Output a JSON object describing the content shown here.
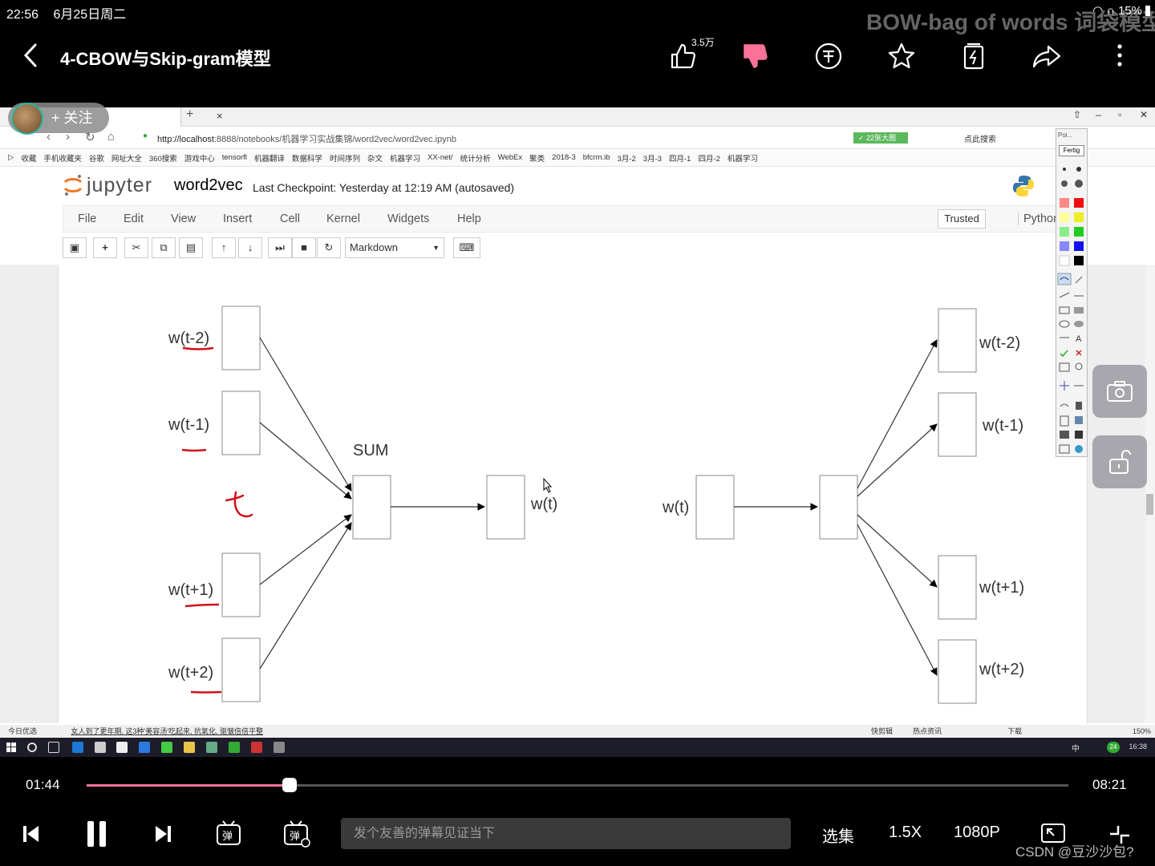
{
  "status_bar": {
    "time": "22:56",
    "date": "6月25日周二",
    "battery": "15%"
  },
  "watermark": "BOW-bag of words 词袋模型",
  "video": {
    "title": "4-CBOW与Skip-gram模型",
    "like_count": "3.5万",
    "icons": [
      "like-icon",
      "dislike-icon",
      "coin-icon",
      "star-icon",
      "collect-icon",
      "share-icon",
      "more-icon"
    ]
  },
  "follow": {
    "label": "+ 关注"
  },
  "browser": {
    "url_host": "http://localhost",
    "url_path": ":8888/notebooks/机器学习实战集锦/word2vec/word2vec.ipynb",
    "badge": "✓ 22张大图",
    "search_label": "点此搜索",
    "bookmarks": [
      "收藏",
      "手机收藏夹",
      "谷歌",
      "网址大全",
      "360搜索",
      "游戏中心",
      "tensorfl",
      "机器翻译",
      "数据科学",
      "时间序列",
      "杂文",
      "机器学习",
      "XX-net/",
      "统计分析",
      "WebEx",
      "聚类",
      "2018-3",
      "bfcrm.ib",
      "3月-2",
      "3月-3",
      "四月-1",
      "四月-2",
      "机器学习"
    ]
  },
  "jupyter": {
    "logo_text": "jupyter",
    "notebook_name": "word2vec",
    "checkpoint": "Last Checkpoint: Yesterday at 12:19 AM (autosaved)",
    "menu": [
      "File",
      "Edit",
      "View",
      "Insert",
      "Cell",
      "Kernel",
      "Widgets",
      "Help"
    ],
    "trusted": "Trusted",
    "kernel": "Python",
    "cell_type": "Markdown"
  },
  "diagram": {
    "cbow": {
      "inputs": [
        "w(t-2)",
        "w(t-1)",
        "w(t+1)",
        "w(t+2)"
      ],
      "sum_label": "SUM",
      "output": "w(t)",
      "handwritten_mark": "t"
    },
    "skipgram": {
      "input": "w(t)",
      "outputs": [
        "w(t-2)",
        "w(t-1)",
        "w(t+1)",
        "w(t+2)"
      ]
    }
  },
  "annotation_tool": {
    "fertig": "Fertig",
    "title": "Poi..."
  },
  "ie_status": {
    "left": "今日优选",
    "news": "女人到了更年期, 这3种'美容汤'吃起来, 抗氧化, 驱皱倍倍平整",
    "zoom": "150%",
    "items": [
      "快剪辑",
      "热点资讯",
      "下载"
    ]
  },
  "taskbar": {
    "clock": "16:38",
    "badge": "24",
    "ime": "中"
  },
  "playback": {
    "current": "01:44",
    "total": "08:21",
    "progress": 0.207,
    "danmaku_placeholder": "发个友善的弹幕见证当下",
    "episodes": "选集",
    "speed": "1.5X",
    "quality": "1080P"
  },
  "source_watermark": "CSDN @豆沙沙包?"
}
